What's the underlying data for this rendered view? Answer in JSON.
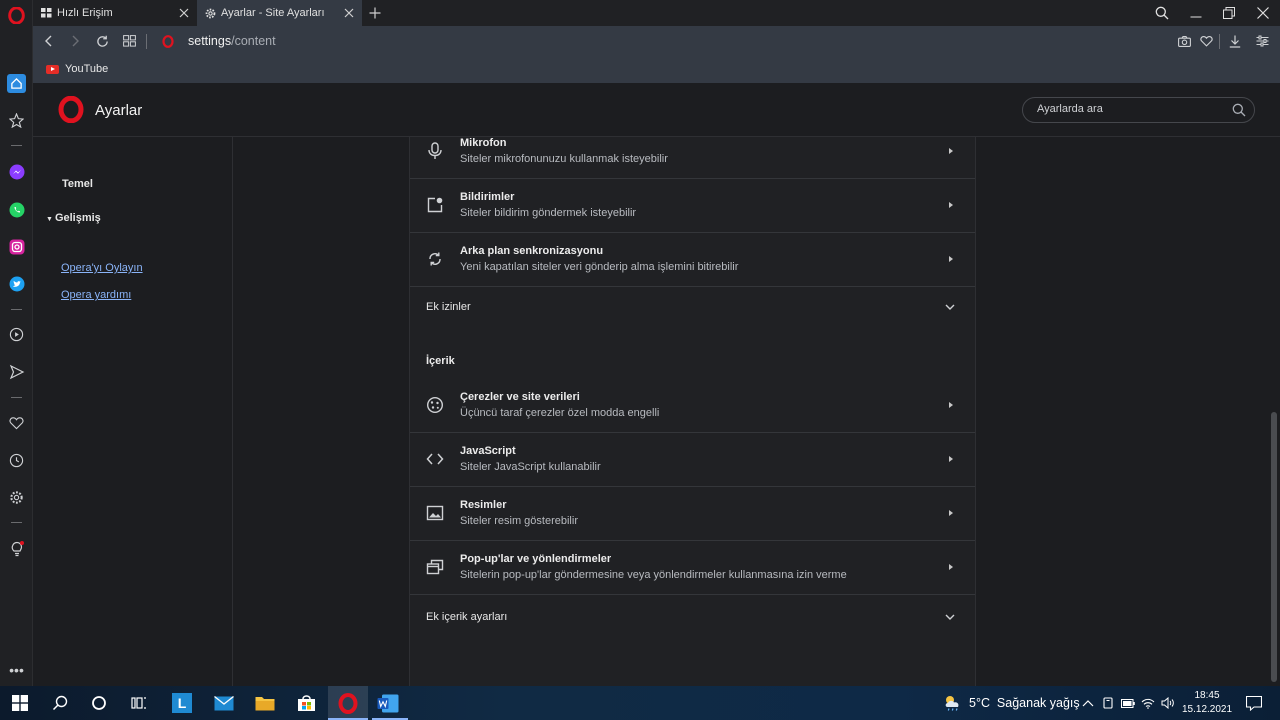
{
  "tabs": [
    {
      "label": "Hızlı Erişim",
      "icon": "grid-icon",
      "active": false
    },
    {
      "label": "Ayarlar - Site Ayarları",
      "icon": "gear-icon",
      "active": true
    }
  ],
  "address": {
    "host": "settings",
    "path": "/content"
  },
  "bookmarks": [
    {
      "label": "YouTube"
    }
  ],
  "header": {
    "title": "Ayarlar",
    "search_placeholder": "Ayarlarda ara"
  },
  "nav": {
    "basic": "Temel",
    "advanced": "Gelişmiş",
    "links": [
      "Opera'yı Oylayın",
      "Opera yardımı"
    ]
  },
  "permissions": [
    {
      "title": "Mikrofon",
      "subtitle": "Siteler mikrofonunuzu kullanmak isteyebilir",
      "icon": "microphone-icon"
    },
    {
      "title": "Bildirimler",
      "subtitle": "Siteler bildirim göndermek isteyebilir",
      "icon": "notification-icon"
    },
    {
      "title": "Arka plan senkronizasyonu",
      "subtitle": "Yeni kapatılan siteler veri gönderip alma işlemini bitirebilir",
      "icon": "sync-icon"
    }
  ],
  "extra_permissions_label": "Ek izinler",
  "content_section_title": "İçerik",
  "content_rows": [
    {
      "title": "Çerezler ve site verileri",
      "subtitle": "Üçüncü taraf çerezler özel modda engelli",
      "icon": "cookie-icon"
    },
    {
      "title": "JavaScript",
      "subtitle": "Siteler JavaScript kullanabilir",
      "icon": "code-icon"
    },
    {
      "title": "Resimler",
      "subtitle": "Siteler resim gösterebilir",
      "icon": "image-icon"
    },
    {
      "title": "Pop-up'lar ve yönlendirmeler",
      "subtitle": "Sitelerin pop-up'lar göndermesine veya yönlendirmeler kullanmasına izin verme",
      "icon": "popup-icon"
    }
  ],
  "extra_content_label": "Ek içerik ayarları",
  "taskbar": {
    "weather": "5°C  Sağanak yağış",
    "time": "18:45",
    "date": "15.12.2021"
  },
  "colors": {
    "opera_red": "#e0121f",
    "accent_blue": "#8ab4f8",
    "background": "#1c1d20"
  }
}
